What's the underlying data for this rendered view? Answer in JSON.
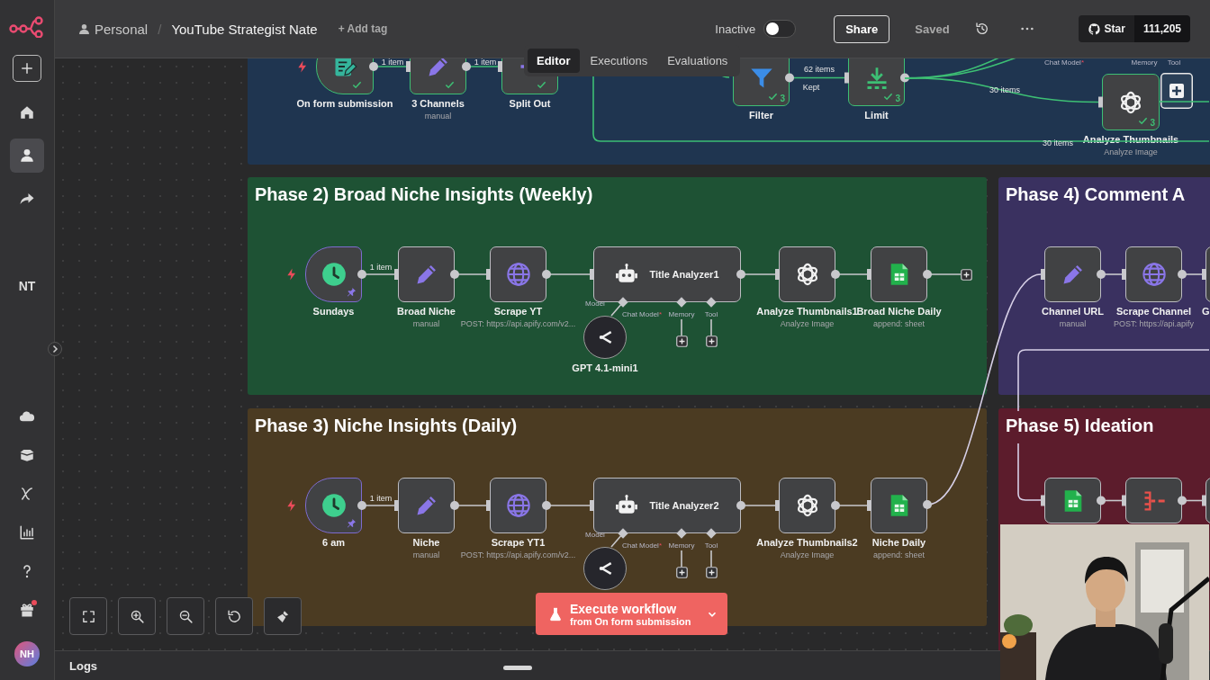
{
  "header": {
    "owner": "Personal",
    "separator": "/",
    "workflow_name": "YouTube Strategist Nate",
    "add_tag": "+ Add tag",
    "status_label": "Inactive",
    "active": false,
    "share": "Share",
    "save_state": "Saved",
    "github": {
      "label": "Star",
      "count": "111,205"
    }
  },
  "tabs": [
    {
      "label": "Editor",
      "selected": true
    },
    {
      "label": "Executions",
      "selected": false
    },
    {
      "label": "Evaluations",
      "selected": false
    }
  ],
  "sidebar": {
    "top_items": [
      {
        "kind": "add",
        "selected": false
      },
      {
        "kind": "home",
        "selected": false
      },
      {
        "kind": "person",
        "selected": true
      },
      {
        "kind": "shared",
        "selected": false
      }
    ],
    "project_initials": "NT",
    "bottom_items": [
      {
        "kind": "cloud",
        "selected": false,
        "badge": false
      },
      {
        "kind": "templates",
        "selected": false,
        "badge": false
      },
      {
        "kind": "variables",
        "selected": false,
        "badge": false
      },
      {
        "kind": "insights",
        "selected": false,
        "badge": false
      },
      {
        "kind": "help",
        "selected": false,
        "badge": false
      },
      {
        "kind": "gift",
        "selected": false,
        "badge": true
      }
    ],
    "user_initials": "NH"
  },
  "groups": [
    {
      "color": "#1f3550",
      "nodes": [
        {
          "kind": "form_trigger",
          "name": "On form submission",
          "success": true
        },
        {
          "kind": "set",
          "name": "3 Channels",
          "subtitle": "manual",
          "success": true
        },
        {
          "kind": "split",
          "name": "Split Out",
          "success": true
        },
        {
          "kind": "filter",
          "name": "Filter",
          "success": true,
          "runs": "3"
        },
        {
          "kind": "limit",
          "name": "Limit",
          "success": true,
          "runs": "3"
        },
        {
          "kind": "openai",
          "name": "Analyze Thumbnails",
          "subtitle": "Analyze Image",
          "success": true,
          "runs": "3"
        }
      ],
      "labels": [
        {
          "text": "1 item"
        },
        {
          "text": "1 item"
        },
        {
          "text": "62 items"
        },
        {
          "text": "Kept"
        },
        {
          "text": "30 items"
        },
        {
          "text": "30 items"
        },
        {
          "text": "Chat Model",
          "required_mark": "*"
        },
        {
          "text": "Memory"
        },
        {
          "text": "Tool"
        }
      ]
    },
    {
      "title": "Phase 2) Broad Niche Insights (Weekly)",
      "color": "#1e5234",
      "nodes": [
        {
          "kind": "schedule",
          "name": "Sundays",
          "pinned": true
        },
        {
          "kind": "set",
          "name": "Broad Niche",
          "subtitle": "manual"
        },
        {
          "kind": "http",
          "name": "Scrape YT",
          "subtitle": "POST: https://api.apify.com/v2..."
        },
        {
          "kind": "agent",
          "name": "Title Analyzer1",
          "ports": [
            {
              "text": "Model"
            },
            {
              "text": "Chat Model",
              "required_mark": "*"
            },
            {
              "text": "Memory"
            },
            {
              "text": "Tool"
            }
          ]
        },
        {
          "kind": "openai",
          "name": "Analyze Thumbnails1",
          "subtitle": "Analyze Image"
        },
        {
          "kind": "sheets",
          "name": "Broad Niche Daily",
          "subtitle": "append: sheet"
        },
        {
          "kind": "model",
          "name": "GPT 4.1-mini1"
        }
      ],
      "labels": [
        {
          "text": "1 item"
        }
      ]
    },
    {
      "title": "Phase 3) Niche Insights (Daily)",
      "color": "#4b3b22",
      "nodes": [
        {
          "kind": "schedule",
          "name": "6 am",
          "pinned": true
        },
        {
          "kind": "set",
          "name": "Niche",
          "subtitle": "manual"
        },
        {
          "kind": "http",
          "name": "Scrape YT1",
          "subtitle": "POST: https://api.apify.com/v2..."
        },
        {
          "kind": "agent",
          "name": "Title Analyzer2",
          "ports": [
            {
              "text": "Model"
            },
            {
              "text": "Chat Model",
              "required_mark": "*"
            },
            {
              "text": "Memory"
            },
            {
              "text": "Tool"
            }
          ]
        },
        {
          "kind": "openai",
          "name": "Analyze Thumbnails2",
          "subtitle": "Analyze Image"
        },
        {
          "kind": "sheets",
          "name": "Niche Daily",
          "subtitle": "append: sheet"
        },
        {
          "kind": "model"
        }
      ],
      "labels": [
        {
          "text": "1 item"
        }
      ]
    },
    {
      "title": "Phase 4) Comment A",
      "color": "#3a3160",
      "nodes": [
        {
          "kind": "set",
          "name": "Channel URL",
          "subtitle": "manual"
        },
        {
          "kind": "http",
          "name": "Scrape Channel",
          "subtitle": "POST: https://api.apify"
        },
        {
          "kind": "cut_off",
          "name": "G"
        }
      ]
    },
    {
      "title": "Phase 5) Ideation",
      "color": "#5c1c2c",
      "nodes": [
        {
          "kind": "sheets"
        },
        {
          "kind": "aggregate"
        },
        {
          "kind": "cut_off"
        }
      ]
    }
  ],
  "canvas_controls": [
    {
      "kind": "fit"
    },
    {
      "kind": "zoom_in"
    },
    {
      "kind": "zoom_out"
    },
    {
      "kind": "reset"
    },
    {
      "kind": "tidy"
    }
  ],
  "execute": {
    "label": "Execute workflow",
    "sublabel": "from On form submission"
  },
  "logs": {
    "label": "Logs"
  }
}
